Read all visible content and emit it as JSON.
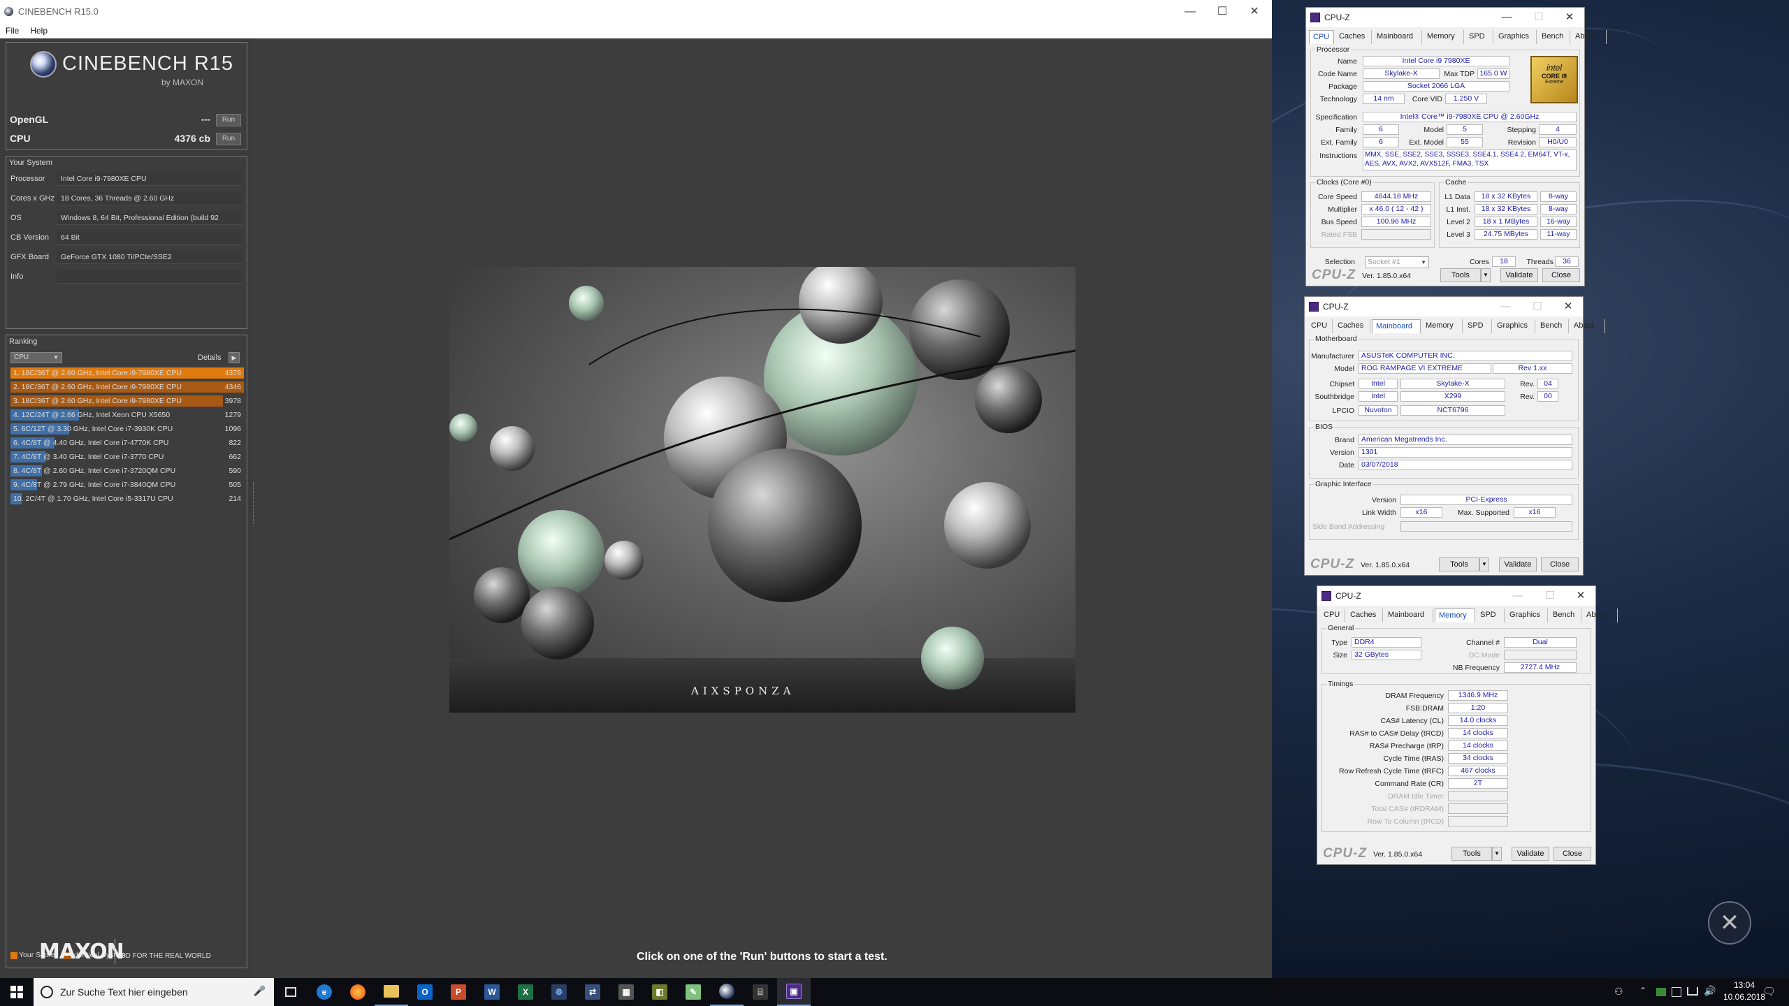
{
  "cinebench": {
    "window_title": "CINEBENCH R15.0",
    "menu": [
      "File",
      "Help"
    ],
    "logo_text": "CINEBENCH R15",
    "logo_by": "by MAXON",
    "opengl_label": "OpenGL",
    "opengl_value": "---",
    "cpu_label": "CPU",
    "cpu_value": "4376 cb",
    "run_label": "Run",
    "your_system_title": "Your System",
    "system": [
      {
        "label": "Processor",
        "value": "Intel Core i9-7980XE CPU"
      },
      {
        "label": "Cores x GHz",
        "value": "18 Cores, 36 Threads @ 2.60 GHz"
      },
      {
        "label": "OS",
        "value": "Windows 8, 64 Bit, Professional Edition (build 92"
      },
      {
        "label": "CB Version",
        "value": "64 Bit"
      },
      {
        "label": "GFX Board",
        "value": "GeForce GTX 1080 Ti/PCIe/SSE2"
      },
      {
        "label": "Info",
        "value": ""
      }
    ],
    "ranking_title": "Ranking",
    "ranking_dropdown": "CPU",
    "details_label": "Details",
    "ranking": [
      {
        "text": "1. 18C/36T @ 2.60 GHz, Intel Core i9-7980XE CPU",
        "score": "4376",
        "fill": 1.0,
        "color": "#e07b10"
      },
      {
        "text": "2. 18C/36T @ 2.60 GHz, Intel Core i9-7980XE CPU",
        "score": "4346",
        "fill": 1.0,
        "color": "#a85a14"
      },
      {
        "text": "3. 18C/36T @ 2.60 GHz, Intel Core i9-7980XE CPU",
        "score": "3978",
        "fill": 0.909,
        "color": "#a85a14"
      },
      {
        "text": "4. 12C/24T @ 2.66 GHz, Intel Xeon CPU X5650",
        "score": "1279",
        "fill": 0.292,
        "color": "#3f6fa8"
      },
      {
        "text": "5. 6C/12T @ 3.30 GHz,  Intel Core i7-3930K CPU",
        "score": "1096",
        "fill": 0.25,
        "color": "#3f6fa8"
      },
      {
        "text": "6. 4C/8T @ 4.40 GHz, Intel Core i7-4770K CPU",
        "score": "822",
        "fill": 0.188,
        "color": "#3f6fa8"
      },
      {
        "text": "7. 4C/8T @ 3.40 GHz,  Intel Core i7-3770 CPU",
        "score": "662",
        "fill": 0.151,
        "color": "#3f6fa8"
      },
      {
        "text": "8. 4C/8T @ 2.60 GHz, Intel Core i7-3720QM CPU",
        "score": "590",
        "fill": 0.135,
        "color": "#3f6fa8"
      },
      {
        "text": "9. 4C/8T @ 2.79 GHz,  Intel Core i7-3840QM CPU",
        "score": "505",
        "fill": 0.115,
        "color": "#3f6fa8"
      },
      {
        "text": "10. 2C/4T @ 1.70 GHz,  Intel Core i5-3317U CPU",
        "score": "214",
        "fill": 0.049,
        "color": "#3f6fa8"
      }
    ],
    "legend_your_score": "Your Score",
    "legend_identical": "Identical System",
    "maxon_logo": "MAXON",
    "maxon_tagline": "3D FOR THE REAL WORLD",
    "status_text": "Click on one of the 'Run' buttons to start a test.",
    "render_watermark": "AIXSPONZA"
  },
  "cpuz1": {
    "title": "CPU-Z",
    "tabs": [
      "CPU",
      "Caches",
      "Mainboard",
      "Memory",
      "SPD",
      "Graphics",
      "Bench",
      "About"
    ],
    "active_tab": "CPU",
    "processor_group": "Processor",
    "name_label": "Name",
    "name": "Intel Core i9 7980XE",
    "codename_label": "Code Name",
    "codename": "Skylake-X",
    "maxtdp_label": "Max TDP",
    "maxtdp": "165.0 W",
    "package_label": "Package",
    "package": "Socket 2066 LGA",
    "technology_label": "Technology",
    "technology": "14 nm",
    "corevid_label": "Core VID",
    "corevid": "1.250 V",
    "spec_label": "Specification",
    "spec": "Intel® Core™ i9-7980XE CPU @ 2.60GHz",
    "family_label": "Family",
    "family": "6",
    "model_label": "Model",
    "model": "5",
    "stepping_label": "Stepping",
    "stepping": "4",
    "extfamily_label": "Ext. Family",
    "extfamily": "6",
    "extmodel_label": "Ext. Model",
    "extmodel": "55",
    "revision_label": "Revision",
    "revision": "H0/U0",
    "instr_label": "Instructions",
    "instr1": "MMX, SSE, SSE2, SSE3, SSSE3, SSE4.1, SSE4.2, EM64T, VT-x,",
    "instr2": "AES, AVX, AVX2, AVX512F, FMA3, TSX",
    "clocks_group": "Clocks (Core #0)",
    "corespeed_label": "Core Speed",
    "corespeed": "4644.18 MHz",
    "multiplier_label": "Multiplier",
    "multiplier": "x 46.0 ( 12 - 42 )",
    "busspeed_label": "Bus Speed",
    "busspeed": "100.96 MHz",
    "ratedfsb_label": "Rated FSB",
    "ratedfsb": "",
    "cache_group": "Cache",
    "l1d_label": "L1 Data",
    "l1d": "18 x 32 KBytes",
    "l1d_way": "8-way",
    "l1i_label": "L1 Inst.",
    "l1i": "18 x 32 KBytes",
    "l1i_way": "8-way",
    "l2_label": "Level 2",
    "l2": "18 x 1 MBytes",
    "l2_way": "16-way",
    "l3_label": "Level 3",
    "l3": "24.75 MBytes",
    "l3_way": "11-way",
    "selection_label": "Selection",
    "selection": "Socket #1",
    "cores_label": "Cores",
    "cores": "18",
    "threads_label": "Threads",
    "threads": "36",
    "badge_line1": "intel",
    "badge_line2": "CORE i9",
    "badge_line3": "Extreme",
    "brand": "CPU-Z",
    "version": "Ver. 1.85.0.x64",
    "tools": "Tools",
    "validate": "Validate",
    "close": "Close"
  },
  "cpuz2": {
    "title": "CPU-Z",
    "tabs": [
      "CPU",
      "Caches",
      "Mainboard",
      "Memory",
      "SPD",
      "Graphics",
      "Bench",
      "About"
    ],
    "active_tab": "Mainboard",
    "mb_group": "Motherboard",
    "manufacturer_label": "Manufacturer",
    "manufacturer": "ASUSTeK COMPUTER INC.",
    "model_label": "Model",
    "model": "ROG RAMPAGE VI EXTREME",
    "model_rev": "Rev 1.xx",
    "chipset_label": "Chipset",
    "chipset": "Intel",
    "chipset2": "Skylake-X",
    "chipset_rev_label": "Rev.",
    "chipset_rev": "04",
    "south_label": "Southbridge",
    "south": "Intel",
    "south2": "X299",
    "south_rev_label": "Rev.",
    "south_rev": "00",
    "lpcio_label": "LPCIO",
    "lpcio": "Nuvoton",
    "lpcio2": "NCT6796",
    "bios_group": "BIOS",
    "brand_label": "Brand",
    "bios_brand": "American Megatrends Inc.",
    "version_label": "Version",
    "bios_version": "1301",
    "date_label": "Date",
    "bios_date": "03/07/2018",
    "gi_group": "Graphic Interface",
    "gi_version_label": "Version",
    "gi_version": "PCI-Express",
    "linkwidth_label": "Link Width",
    "linkwidth": "x16",
    "maxsupported_label": "Max. Supported",
    "maxsupported": "x16",
    "sideband_label": "Side Band Addressing",
    "brand": "CPU-Z",
    "version": "Ver. 1.85.0.x64",
    "tools": "Tools",
    "validate": "Validate",
    "close": "Close"
  },
  "cpuz3": {
    "title": "CPU-Z",
    "tabs": [
      "CPU",
      "Caches",
      "Mainboard",
      "Memory",
      "SPD",
      "Graphics",
      "Bench",
      "About"
    ],
    "active_tab": "Memory",
    "general_group": "General",
    "type_label": "Type",
    "type": "DDR4",
    "channel_label": "Channel #",
    "channel": "Dual",
    "size_label": "Size",
    "size": "32 GBytes",
    "dcmode_label": "DC Mode",
    "nbfreq_label": "NB Frequency",
    "nbfreq": "2727.4 MHz",
    "timings_group": "Timings",
    "timings": [
      {
        "label": "DRAM Frequency",
        "value": "1346.9 MHz",
        "disabled": false
      },
      {
        "label": "FSB:DRAM",
        "value": "1:20",
        "disabled": false
      },
      {
        "label": "CAS# Latency (CL)",
        "value": "14.0 clocks",
        "disabled": false
      },
      {
        "label": "RAS# to CAS# Delay (tRCD)",
        "value": "14 clocks",
        "disabled": false
      },
      {
        "label": "RAS# Precharge (tRP)",
        "value": "14 clocks",
        "disabled": false
      },
      {
        "label": "Cycle Time (tRAS)",
        "value": "34 clocks",
        "disabled": false
      },
      {
        "label": "Row Refresh Cycle Time (tRFC)",
        "value": "467 clocks",
        "disabled": false
      },
      {
        "label": "Command Rate (CR)",
        "value": "2T",
        "disabled": false
      },
      {
        "label": "DRAM Idle Timer",
        "value": "",
        "disabled": true
      },
      {
        "label": "Total CAS# (tRDRAM)",
        "value": "",
        "disabled": true
      },
      {
        "label": "Row To Column (tRCD)",
        "value": "",
        "disabled": true
      }
    ],
    "brand": "CPU-Z",
    "version": "Ver. 1.85.0.x64",
    "tools": "Tools",
    "validate": "Validate",
    "close": "Close"
  },
  "taskbar": {
    "search_placeholder": "Zur Suche Text hier eingeben",
    "time": "13:04",
    "date": "10.06.2018"
  }
}
